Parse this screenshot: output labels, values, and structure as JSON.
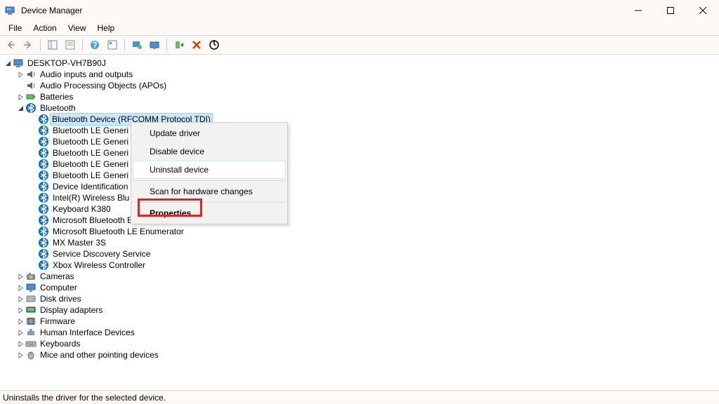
{
  "window": {
    "title": "Device Manager"
  },
  "menubar": [
    "File",
    "Action",
    "View",
    "Help"
  ],
  "status": "Uninstalls the driver for the selected device.",
  "context_menu": {
    "items": [
      {
        "label": "Update driver"
      },
      {
        "label": "Disable device"
      },
      {
        "label": "Uninstall device",
        "hovered": true
      },
      {
        "separator": true
      },
      {
        "label": "Scan for hardware changes"
      },
      {
        "separator": true
      },
      {
        "label": "Properties",
        "bold": true,
        "highlighted": true
      }
    ]
  },
  "tree": [
    {
      "depth": 0,
      "exp": "open",
      "icon": "computer",
      "label": "DESKTOP-VH7B90J"
    },
    {
      "depth": 1,
      "exp": "closed",
      "icon": "audio",
      "label": "Audio inputs and outputs"
    },
    {
      "depth": 1,
      "exp": "none",
      "icon": "audio",
      "label": "Audio Processing Objects (APOs)"
    },
    {
      "depth": 1,
      "exp": "closed",
      "icon": "battery",
      "label": "Batteries"
    },
    {
      "depth": 1,
      "exp": "open",
      "icon": "bluetooth",
      "label": "Bluetooth"
    },
    {
      "depth": 2,
      "exp": "none",
      "icon": "bluetooth",
      "label": "Bluetooth Device (RFCOMM Protocol TDI)",
      "selected": true
    },
    {
      "depth": 2,
      "exp": "none",
      "icon": "bluetooth",
      "label": "Bluetooth LE Generi"
    },
    {
      "depth": 2,
      "exp": "none",
      "icon": "bluetooth",
      "label": "Bluetooth LE Generi"
    },
    {
      "depth": 2,
      "exp": "none",
      "icon": "bluetooth",
      "label": "Bluetooth LE Generi"
    },
    {
      "depth": 2,
      "exp": "none",
      "icon": "bluetooth",
      "label": "Bluetooth LE Generi"
    },
    {
      "depth": 2,
      "exp": "none",
      "icon": "bluetooth",
      "label": "Bluetooth LE Generi"
    },
    {
      "depth": 2,
      "exp": "none",
      "icon": "bluetooth",
      "label": "Device Identification"
    },
    {
      "depth": 2,
      "exp": "none",
      "icon": "bluetooth",
      "label": "Intel(R) Wireless Blu"
    },
    {
      "depth": 2,
      "exp": "none",
      "icon": "bluetooth",
      "label": "Keyboard K380"
    },
    {
      "depth": 2,
      "exp": "none",
      "icon": "bluetooth",
      "label": "Microsoft Bluetooth Enumerator"
    },
    {
      "depth": 2,
      "exp": "none",
      "icon": "bluetooth",
      "label": "Microsoft Bluetooth LE Enumerator"
    },
    {
      "depth": 2,
      "exp": "none",
      "icon": "bluetooth",
      "label": "MX Master 3S"
    },
    {
      "depth": 2,
      "exp": "none",
      "icon": "bluetooth",
      "label": "Service Discovery Service"
    },
    {
      "depth": 2,
      "exp": "none",
      "icon": "bluetooth",
      "label": "Xbox Wireless Controller"
    },
    {
      "depth": 1,
      "exp": "closed",
      "icon": "camera",
      "label": "Cameras"
    },
    {
      "depth": 1,
      "exp": "closed",
      "icon": "monitor",
      "label": "Computer"
    },
    {
      "depth": 1,
      "exp": "closed",
      "icon": "disk",
      "label": "Disk drives"
    },
    {
      "depth": 1,
      "exp": "closed",
      "icon": "display",
      "label": "Display adapters"
    },
    {
      "depth": 1,
      "exp": "closed",
      "icon": "firmware",
      "label": "Firmware"
    },
    {
      "depth": 1,
      "exp": "closed",
      "icon": "hid",
      "label": "Human Interface Devices"
    },
    {
      "depth": 1,
      "exp": "closed",
      "icon": "keyboard",
      "label": "Keyboards"
    },
    {
      "depth": 1,
      "exp": "closed",
      "icon": "mouse",
      "label": "Mice and other pointing devices"
    }
  ]
}
